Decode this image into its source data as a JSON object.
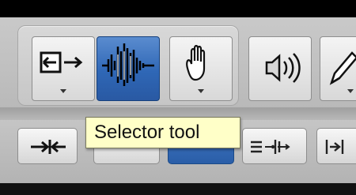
{
  "toolbar": {
    "tools": [
      {
        "icon": "trim-arrow-icon",
        "has_dropdown": true
      },
      {
        "icon": "selector-waveform-icon",
        "selected": true
      },
      {
        "icon": "grabber-hand-icon",
        "has_dropdown": true
      },
      {
        "icon": "speaker-icon"
      },
      {
        "icon": "pencil-icon",
        "has_dropdown": true
      }
    ],
    "edit_tools": [
      {
        "icon": "shuffle-arrows-icon"
      },
      {
        "icon": "slip-icon"
      },
      {
        "icon": "spot-icon",
        "selected": true
      },
      {
        "icon": "grid-icon"
      },
      {
        "icon": "snap-icon"
      }
    ]
  },
  "tooltip": {
    "text": "Selector tool"
  },
  "colors": {
    "selected": "#2f67b6",
    "tooltip_bg": "#ffffc8"
  }
}
